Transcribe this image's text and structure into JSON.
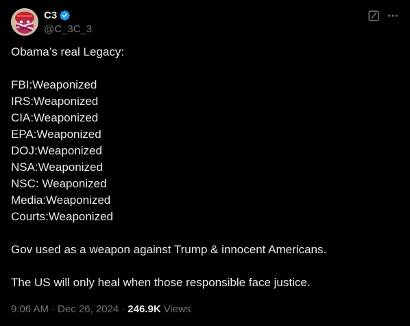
{
  "author": {
    "display_name": "C3",
    "handle": "@C_3C_3",
    "verified": true,
    "avatar_icon": "avatar-image"
  },
  "actions": {
    "grok_icon": "grok-icon",
    "more_icon": "more-icon"
  },
  "tweet": {
    "intro": "Obama’s real Legacy:",
    "list": [
      "FBI:Weaponized",
      "IRS:Weaponized",
      "CIA:Weaponized",
      "EPA:Weaponized",
      "DOJ:Weaponized",
      "NSA:Weaponized",
      "NSC: Weaponized",
      "Media:Weaponized",
      "Courts:Weaponized"
    ],
    "paragraph1": "Gov used as a weapon against Trump & innocent Americans.",
    "paragraph2": "The US will only heal when those responsible face justice."
  },
  "meta": {
    "time": "9:06 AM",
    "separator": "·",
    "date": "Dec 26, 2024",
    "views_count": "246.9K",
    "views_label": "Views"
  },
  "colors": {
    "background": "#000000",
    "text": "#e7e9ea",
    "muted": "#71767b",
    "verified_blue": "#1d9bf0"
  }
}
